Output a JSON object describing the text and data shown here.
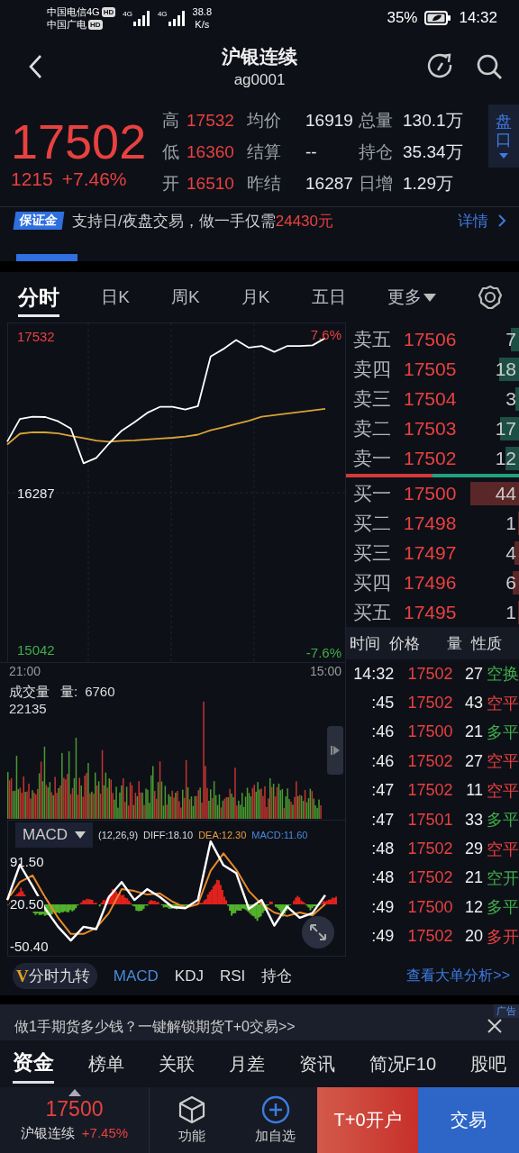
{
  "status_bar": {
    "carrier_1": "中国电信4G",
    "carrier_1_badge": "HD",
    "carrier_2": "中国广电",
    "carrier_2_badge": "HD",
    "signal_1": "4G",
    "signal_2": "4G",
    "speed": "38.8",
    "speed_unit": "K/s",
    "battery": "35%",
    "time": "14:32"
  },
  "header": {
    "title": "沪银连续",
    "code": "ag0001"
  },
  "quote": {
    "price": "17502",
    "change": "1215",
    "change_pct": "+7.46%",
    "side_tab": "盘口",
    "stats": [
      {
        "label": "高",
        "value": "17532",
        "color": "#e8413f"
      },
      {
        "label": "均价",
        "value": "16919",
        "color": "#e8e8ea"
      },
      {
        "label": "总量",
        "value": "130.1万",
        "color": "#e8e8ea"
      },
      {
        "label": "低",
        "value": "16360",
        "color": "#e8413f"
      },
      {
        "label": "结算",
        "value": "--",
        "color": "#e8e8ea"
      },
      {
        "label": "持仓",
        "value": "35.34万",
        "color": "#e8e8ea"
      },
      {
        "label": "开",
        "value": "16510",
        "color": "#e8413f"
      },
      {
        "label": "昨结",
        "value": "16287",
        "color": "#e8e8ea"
      },
      {
        "label": "日增",
        "value": "1.29万",
        "color": "#e8e8ea"
      }
    ]
  },
  "banner": {
    "badge": "保证金",
    "text": "支持日/夜盘交易，做一手仅需",
    "highlight": "24430元",
    "link": "详情"
  },
  "tabs": [
    {
      "label": "分时",
      "selected": true
    },
    {
      "label": "日K",
      "selected": false
    },
    {
      "label": "周K",
      "selected": false
    },
    {
      "label": "月K",
      "selected": false
    },
    {
      "label": "五日",
      "selected": false
    },
    {
      "label": "更多",
      "selected": false,
      "kind": "menu"
    }
  ],
  "chart": {
    "y_max_pct": "7.6%",
    "y_min_pct": "-7.6%",
    "time_start": "21:00",
    "time_end": "15:00",
    "chart_data": {
      "type": "line",
      "categories": [
        null,
        null,
        null,
        null,
        null,
        null,
        null,
        null,
        null,
        null,
        null,
        null,
        null,
        null,
        null,
        null,
        null,
        null,
        null,
        null,
        null,
        null,
        null,
        null,
        null,
        null
      ],
      "ylim": [
        14938,
        17643
      ],
      "yticks": [
        {
          "value": 17532,
          "label": "17532"
        },
        {
          "value": 16287,
          "label": "16287"
        },
        {
          "value": 15042,
          "label": "15042"
        }
      ],
      "series": [
        {
          "color": "#ffffff",
          "values": [
            16700,
            16882,
            16899,
            16897,
            16863,
            16806,
            16529,
            16572,
            16685,
            16788,
            16856,
            16930,
            16978,
            16978,
            16956,
            16984,
            17380,
            17439,
            17511,
            17450,
            17463,
            17416,
            17462,
            17462,
            17468,
            17525
          ]
        },
        {
          "color": "#d9a235",
          "values": [
            16678,
            16764,
            16776,
            16775,
            16766,
            16747,
            16729,
            16709,
            16701,
            16708,
            16712,
            16719,
            16726,
            16732,
            16742,
            16757,
            16791,
            16816,
            16842,
            16867,
            16899,
            16912,
            16924,
            16937,
            16950,
            16963
          ]
        }
      ]
    }
  },
  "volume": {
    "title": "成交量",
    "label": "量:",
    "value": "6760",
    "max": "22135"
  },
  "macd": {
    "selector": "MACD",
    "params": "(12,26,9)",
    "diff": "DIFF:18.10",
    "dea": "DEA:12.30",
    "macd": "MACD:11.60",
    "chart_data": {
      "type": "line",
      "categories": [
        null,
        null,
        null,
        null,
        null,
        null,
        null,
        null,
        null,
        null,
        null,
        null,
        null,
        null,
        null,
        null,
        null,
        null,
        null,
        null,
        null,
        null,
        null,
        null,
        null,
        null
      ],
      "ylim": [
        -65.5,
        160.9
      ],
      "yticks": [
        {
          "value": 91.5,
          "label": "91.50"
        },
        {
          "value": 20.5,
          "label": "20.50"
        },
        {
          "value": -50.4,
          "label": "-50.40"
        }
      ],
      "series": [
        {
          "color": "#ffffff",
          "values": [
            28,
            87,
            51,
            13,
            -17,
            -40,
            -17,
            -21,
            33,
            58,
            28,
            46,
            33,
            16,
            14,
            28,
            126,
            86,
            73,
            13,
            28,
            -15,
            17,
            -2,
            6,
            36
          ]
        },
        {
          "color": "#e88a2a",
          "values": [
            28,
            58,
            69,
            32,
            -2,
            -29,
            -29,
            -19,
            6,
            46,
            43,
            37,
            39,
            25,
            15,
            21,
            77,
            106,
            79,
            43,
            21,
            7,
            1,
            7,
            2,
            21
          ]
        }
      ]
    }
  },
  "order_book": {
    "asks": [
      {
        "label": "卖五",
        "price": "17506",
        "volume": "7"
      },
      {
        "label": "卖四",
        "price": "17505",
        "volume": "18"
      },
      {
        "label": "卖三",
        "price": "17504",
        "volume": "3"
      },
      {
        "label": "卖二",
        "price": "17503",
        "volume": "17"
      },
      {
        "label": "卖一",
        "price": "17502",
        "volume": "12"
      }
    ],
    "split": {
      "level": 0.5
    },
    "bids": [
      {
        "label": "买一",
        "price": "17500",
        "volume": "44"
      },
      {
        "label": "买二",
        "price": "17498",
        "volume": "1"
      },
      {
        "label": "买三",
        "price": "17497",
        "volume": "4"
      },
      {
        "label": "买四",
        "price": "17496",
        "volume": "6"
      },
      {
        "label": "买五",
        "price": "17495",
        "volume": "1"
      }
    ]
  },
  "trades": {
    "columns": [
      "时间",
      "价格",
      "量",
      "性质"
    ],
    "rows": [
      {
        "time": "14:32",
        "price": "17502",
        "volume": "27",
        "type": "空换",
        "color": "#3fae49"
      },
      {
        "time": ":45",
        "price": "17502",
        "volume": "43",
        "type": "空平",
        "color": "#e8413f"
      },
      {
        "time": ":46",
        "price": "17500",
        "volume": "21",
        "type": "多平",
        "color": "#3fae49"
      },
      {
        "time": ":46",
        "price": "17502",
        "volume": "27",
        "type": "空平",
        "color": "#e8413f"
      },
      {
        "time": ":47",
        "price": "17502",
        "volume": "11",
        "type": "空平",
        "color": "#e8413f"
      },
      {
        "time": ":47",
        "price": "17501",
        "volume": "33",
        "type": "多平",
        "color": "#3fae49"
      },
      {
        "time": ":48",
        "price": "17502",
        "volume": "29",
        "type": "空平",
        "color": "#e8413f"
      },
      {
        "time": ":48",
        "price": "17502",
        "volume": "21",
        "type": "空开",
        "color": "#3fae49"
      },
      {
        "time": ":49",
        "price": "17500",
        "volume": "12",
        "type": "多平",
        "color": "#3fae49"
      },
      {
        "time": ":49",
        "price": "17502",
        "volume": "20",
        "type": "多开",
        "color": "#e8413f"
      }
    ]
  },
  "indicators": {
    "badge": "V",
    "pill": "分时九转",
    "items": [
      {
        "label": "MACD",
        "selected": true
      },
      {
        "label": "KDJ",
        "selected": false
      },
      {
        "label": "RSI",
        "selected": false
      },
      {
        "label": "持仓",
        "selected": false
      }
    ],
    "link": "查看大单分析>>"
  },
  "ad": {
    "text": "做1手期货多少钱？一键解锁期货T+0交易>>",
    "badge": "广告"
  },
  "bottom_tabs": [
    {
      "label": "资金",
      "selected": true
    },
    {
      "label": "榜单",
      "selected": false
    },
    {
      "label": "关联",
      "selected": false
    },
    {
      "label": "月差",
      "selected": false
    },
    {
      "label": "资讯",
      "selected": false
    },
    {
      "label": "简况F10",
      "selected": false
    },
    {
      "label": "股吧",
      "selected": false
    }
  ],
  "footer": {
    "price": "17500",
    "name": "沪银连续",
    "change_pct": "+7.45%",
    "actions": [
      {
        "label": "功能",
        "kind": "cube"
      },
      {
        "label": "加自选",
        "kind": "add"
      }
    ],
    "buttons": [
      {
        "label": "T+0开户",
        "kind": "open"
      },
      {
        "label": "交易",
        "kind": "trade"
      }
    ]
  }
}
